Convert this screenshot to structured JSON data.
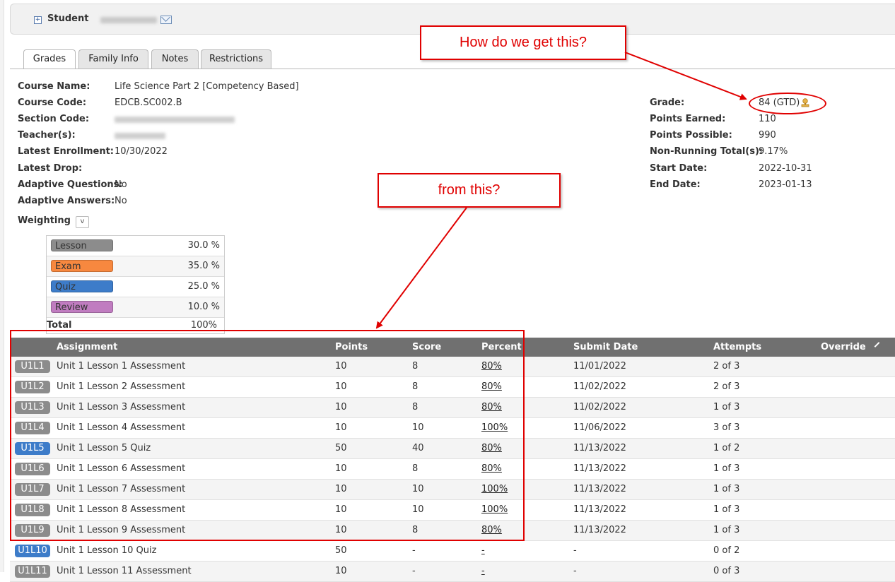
{
  "student": {
    "label": "Student"
  },
  "tabs": [
    {
      "label": "Grades",
      "active": true
    },
    {
      "label": "Family Info",
      "active": false
    },
    {
      "label": "Notes",
      "active": false
    },
    {
      "label": "Restrictions",
      "active": false
    }
  ],
  "course": {
    "name_label": "Course Name:",
    "name": "Life Science Part 2 [Competency Based]",
    "code_label": "Course Code:",
    "code": "EDCB.SC002.B",
    "section_label": "Section Code:",
    "teacher_label": "Teacher(s):",
    "enrollment_label": "Latest Enrollment:",
    "enrollment": "10/30/2022",
    "drop_label": "Latest Drop:",
    "adaptive_q_label": "Adaptive Questions:",
    "adaptive_q": "No",
    "adaptive_a_label": "Adaptive Answers:",
    "adaptive_a": "No"
  },
  "summary": {
    "grade_label": "Grade:",
    "grade": "84 (GTD)",
    "earned_label": "Points Earned:",
    "earned": "110",
    "possible_label": "Points Possible:",
    "possible": "990",
    "nonrunning_label": "Non-Running Total(s):",
    "nonrunning": "9.17%",
    "start_label": "Start Date:",
    "start": "2022-10-31",
    "end_label": "End Date:",
    "end": "2023-01-13"
  },
  "weighting": {
    "label": "Weighting",
    "toggle": "v",
    "rows": [
      {
        "name": "Lesson",
        "pct": "30.0  %",
        "color": "#8c8c8c"
      },
      {
        "name": "Exam",
        "pct": "35.0  %",
        "color": "#f7883f"
      },
      {
        "name": "Quiz",
        "pct": "25.0  %",
        "color": "#3d7cc9"
      },
      {
        "name": "Review",
        "pct": "10.0  %",
        "color": "#c07cc0"
      }
    ],
    "total_label": "Total",
    "total": "100%"
  },
  "grid": {
    "headers": {
      "assignment": "Assignment",
      "points": "Points",
      "score": "Score",
      "percent": "Percent",
      "submit": "Submit Date",
      "attempts": "Attempts",
      "override": "Override"
    },
    "rows": [
      {
        "code": "U1L1",
        "color": "#8c8c8c",
        "name": "Unit 1 Lesson 1 Assessment",
        "points": "10",
        "score": "8",
        "percent": "80%",
        "submit": "11/01/2022",
        "attempts": "2 of 3"
      },
      {
        "code": "U1L2",
        "color": "#8c8c8c",
        "name": "Unit 1 Lesson 2 Assessment",
        "points": "10",
        "score": "8",
        "percent": "80%",
        "submit": "11/02/2022",
        "attempts": "2 of 3"
      },
      {
        "code": "U1L3",
        "color": "#8c8c8c",
        "name": "Unit 1 Lesson 3 Assessment",
        "points": "10",
        "score": "8",
        "percent": "80%",
        "submit": "11/02/2022",
        "attempts": "1 of 3"
      },
      {
        "code": "U1L4",
        "color": "#8c8c8c",
        "name": "Unit 1 Lesson 4 Assessment",
        "points": "10",
        "score": "10",
        "percent": "100%",
        "submit": "11/06/2022",
        "attempts": "3 of 3"
      },
      {
        "code": "U1L5",
        "color": "#3d7cc9",
        "name": "Unit 1 Lesson 5 Quiz",
        "points": "50",
        "score": "40",
        "percent": "80%",
        "submit": "11/13/2022",
        "attempts": "1 of 2"
      },
      {
        "code": "U1L6",
        "color": "#8c8c8c",
        "name": "Unit 1 Lesson 6 Assessment",
        "points": "10",
        "score": "8",
        "percent": "80%",
        "submit": "11/13/2022",
        "attempts": "1 of 3"
      },
      {
        "code": "U1L7",
        "color": "#8c8c8c",
        "name": "Unit 1 Lesson 7 Assessment",
        "points": "10",
        "score": "10",
        "percent": "100%",
        "submit": "11/13/2022",
        "attempts": "1 of 3"
      },
      {
        "code": "U1L8",
        "color": "#8c8c8c",
        "name": "Unit 1 Lesson 8 Assessment",
        "points": "10",
        "score": "10",
        "percent": "100%",
        "submit": "11/13/2022",
        "attempts": "1 of 3"
      },
      {
        "code": "U1L9",
        "color": "#8c8c8c",
        "name": "Unit 1 Lesson 9 Assessment",
        "points": "10",
        "score": "8",
        "percent": "80%",
        "submit": "11/13/2022",
        "attempts": "1 of 3"
      },
      {
        "code": "U1L10",
        "color": "#3d7cc9",
        "name": "Unit 1 Lesson 10 Quiz",
        "points": "50",
        "score": "-",
        "percent": "-",
        "submit": "-",
        "attempts": "0 of 2"
      },
      {
        "code": "U1L11",
        "color": "#8c8c8c",
        "name": "Unit 1 Lesson 11 Assessment",
        "points": "10",
        "score": "-",
        "percent": "-",
        "submit": "-",
        "attempts": "0 of 3"
      }
    ]
  },
  "annotations": {
    "callout1": "How do we get this?",
    "callout2": "from this?"
  },
  "icons": {
    "expand": "plus-box-icon",
    "email": "envelope-icon",
    "certificate": "certificate-icon",
    "edit": "pencil-icon"
  }
}
